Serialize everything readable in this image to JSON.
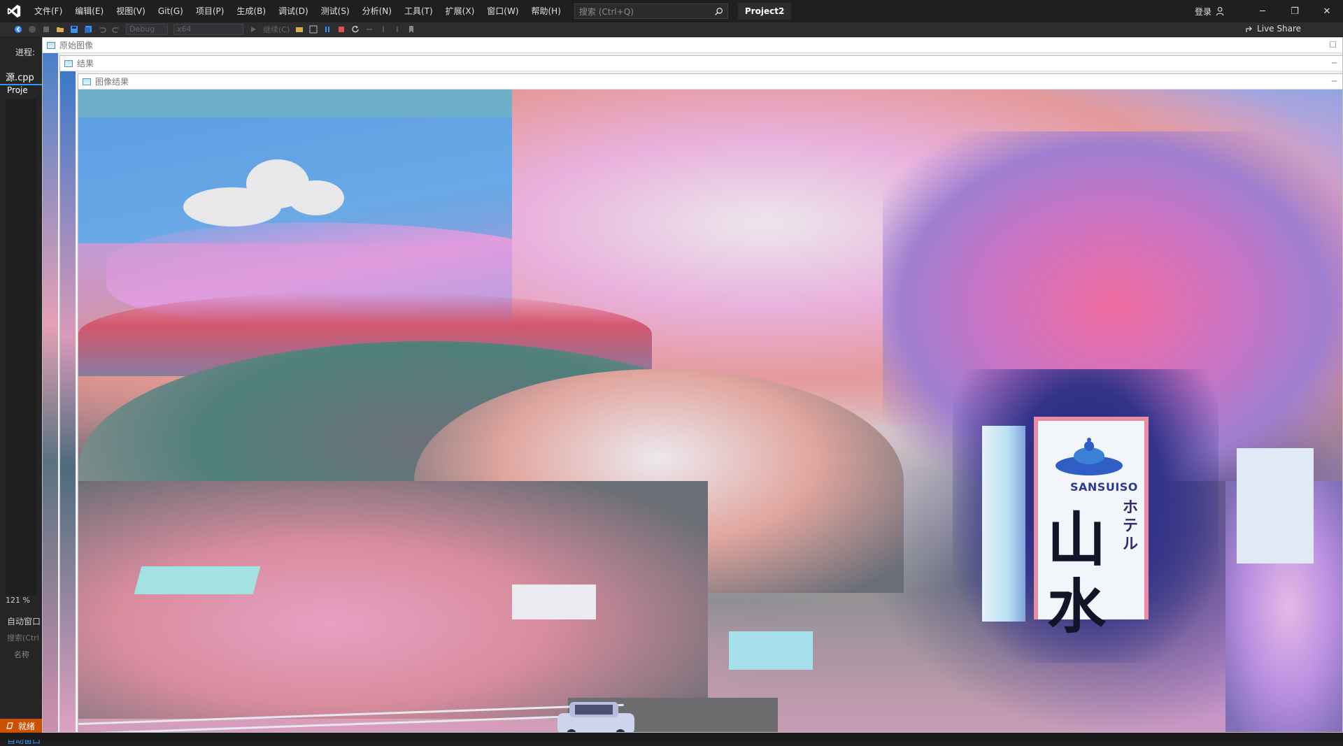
{
  "titlebar": {
    "menus": [
      "文件(F)",
      "编辑(E)",
      "视图(V)",
      "Git(G)",
      "项目(P)",
      "生成(B)",
      "调试(D)",
      "测试(S)",
      "分析(N)",
      "工具(T)",
      "扩展(X)",
      "窗口(W)",
      "帮助(H)"
    ],
    "search_placeholder": "搜索 (Ctrl+Q)",
    "project_name": "Project2",
    "login_label": "登录",
    "win_minimize": "─",
    "win_restore": "❐",
    "win_close": "✕"
  },
  "toolbar": {
    "config": "Debug",
    "platform": "x64",
    "continue_label": "继续(C)",
    "live_share": "Live Share"
  },
  "left_panel": {
    "process_label": "进程:",
    "file_tab": "源.cpp",
    "project_tab": "Proje",
    "zoom": "121 %",
    "autos_title": "自动窗口",
    "autos_search": "搜索(Ctrl",
    "name_column": "名称",
    "autos_tab": "自动窗口"
  },
  "status": {
    "ready": "就绪"
  },
  "windows": {
    "original_title": "原始图像",
    "result_title": "结果",
    "image_result_title": "图像结果",
    "restore_glyph": "☐",
    "minimize_glyph": "─"
  },
  "image_text": {
    "sign_brand": "SANSUISO",
    "sign_kana": "ホテル",
    "sign_kanji": "山水"
  },
  "colors": {
    "accent": "#3794ff",
    "status_bar": "#ca5100",
    "sign_border": "#e98ca8",
    "sign_text": "#2d3b8f"
  }
}
